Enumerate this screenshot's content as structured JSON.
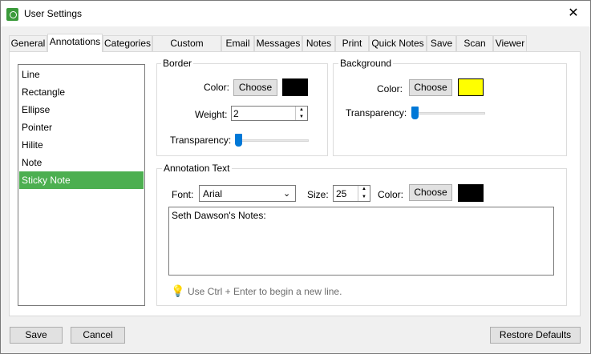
{
  "window": {
    "title": "User Settings"
  },
  "tabs": [
    "General",
    "Annotations",
    "Categories",
    "Custom Stamps",
    "Email",
    "Messages",
    "Notes",
    "Print",
    "Quick Notes",
    "Save",
    "Scan",
    "Viewer"
  ],
  "annotation_types": [
    "Line",
    "Rectangle",
    "Ellipse",
    "Pointer",
    "Hilite",
    "Note",
    "Sticky Note"
  ],
  "selected_type": "Sticky Note",
  "border": {
    "group_label": "Border",
    "color_label": "Color:",
    "choose_label": "Choose",
    "color": "#000000",
    "weight_label": "Weight:",
    "weight": "2",
    "transparency_label": "Transparency:",
    "transparency_level": 0
  },
  "background": {
    "group_label": "Background",
    "color_label": "Color:",
    "choose_label": "Choose",
    "color": "#ffff00",
    "transparency_label": "Transparency:",
    "transparency_level": 0
  },
  "annotation_text": {
    "group_label": "Annotation Text",
    "font_label": "Font:",
    "font": "Arial",
    "size_label": "Size:",
    "size": "25",
    "color_label": "Color:",
    "choose_label": "Choose",
    "color": "#000000",
    "text": "Seth Dawson's Notes:",
    "hint": "Use Ctrl + Enter to begin a new line."
  },
  "footer": {
    "save": "Save",
    "cancel": "Cancel",
    "restore": "Restore Defaults"
  }
}
